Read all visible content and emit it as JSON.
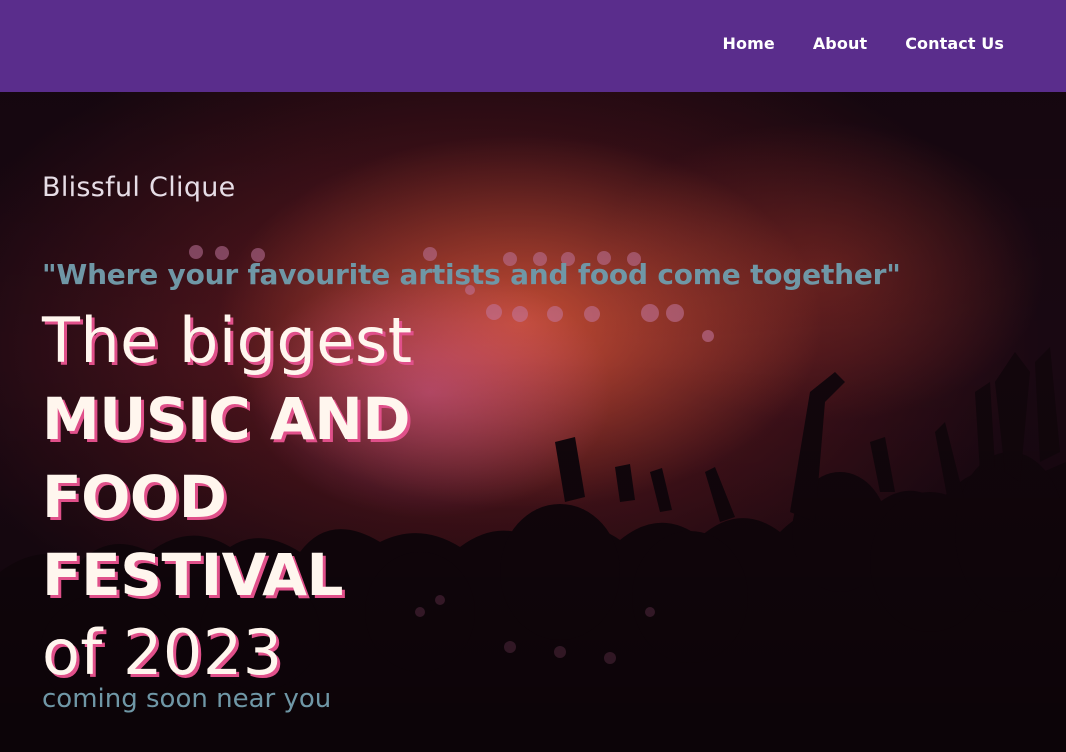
{
  "nav": {
    "items": [
      {
        "label": "Home"
      },
      {
        "label": "About"
      },
      {
        "label": "Contact Us"
      }
    ]
  },
  "hero": {
    "brand": "Blissful Clique",
    "tagline": "\"Where your favourite artists and food come together\"",
    "headline": {
      "line1": "The biggest",
      "line2": "MUSIC AND",
      "line3": "FOOD",
      "line4": "FESTIVAL",
      "line5": "of 2023"
    },
    "subline": "coming soon near you",
    "background_image": "concert-crowd-stage-lights"
  },
  "colors": {
    "navbar": "#5a2d8c",
    "nav_text": "#ffffff",
    "brand_text": "#e6dde6",
    "accent_text": "#6f97a6",
    "headline_text": "#fff6ee",
    "headline_shadow": "#e0508a"
  }
}
